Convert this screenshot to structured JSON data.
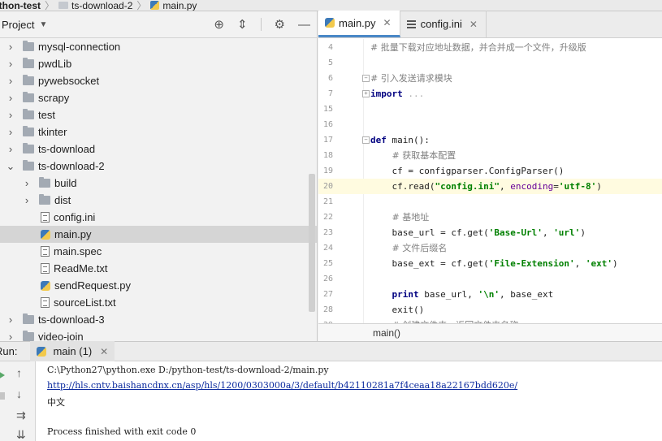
{
  "breadcrumb": [
    "ython-test",
    "ts-download-2",
    "main.py"
  ],
  "project": {
    "title": "Project",
    "items": [
      {
        "label": "mysql-connection",
        "type": "folder",
        "level": 0,
        "arrow": "›"
      },
      {
        "label": "pwdLib",
        "type": "folder",
        "level": 0,
        "arrow": "›"
      },
      {
        "label": "pywebsocket",
        "type": "folder",
        "level": 0,
        "arrow": "›"
      },
      {
        "label": "scrapy",
        "type": "folder",
        "level": 0,
        "arrow": "›"
      },
      {
        "label": "test",
        "type": "folder",
        "level": 0,
        "arrow": "›"
      },
      {
        "label": "tkinter",
        "type": "folder",
        "level": 0,
        "arrow": "›"
      },
      {
        "label": "ts-download",
        "type": "folder",
        "level": 0,
        "arrow": "›"
      },
      {
        "label": "ts-download-2",
        "type": "folder",
        "level": 0,
        "arrow": "⌄"
      },
      {
        "label": "build",
        "type": "folder",
        "level": 1,
        "arrow": "›"
      },
      {
        "label": "dist",
        "type": "folder",
        "level": 1,
        "arrow": "›"
      },
      {
        "label": "config.ini",
        "type": "file",
        "level": 1,
        "arrow": ""
      },
      {
        "label": "main.py",
        "type": "py",
        "level": 1,
        "arrow": "",
        "selected": true
      },
      {
        "label": "main.spec",
        "type": "file",
        "level": 1,
        "arrow": ""
      },
      {
        "label": "ReadMe.txt",
        "type": "file",
        "level": 1,
        "arrow": ""
      },
      {
        "label": "sendRequest.py",
        "type": "py",
        "level": 1,
        "arrow": ""
      },
      {
        "label": "sourceList.txt",
        "type": "file",
        "level": 1,
        "arrow": ""
      },
      {
        "label": "ts-download-3",
        "type": "folder",
        "level": 0,
        "arrow": "›"
      },
      {
        "label": "video-join",
        "type": "folder",
        "level": 0,
        "arrow": "›"
      }
    ]
  },
  "editor": {
    "tabs": [
      {
        "label": "main.py",
        "active": true
      },
      {
        "label": "config.ini",
        "active": false
      }
    ],
    "lines": [
      {
        "n": "4",
        "html": "<span class='cm'># 批量下载对应地址数据，并合并成一个文件，升级版</span>"
      },
      {
        "n": "5",
        "html": ""
      },
      {
        "n": "6",
        "html": "<span class='cm'># 引入发送请求模块</span>"
      },
      {
        "n": "7",
        "html": "<span class='kw'>import</span> <span class='fold'>...</span>"
      },
      {
        "n": "15",
        "html": ""
      },
      {
        "n": "16",
        "html": ""
      },
      {
        "n": "17",
        "html": "<span class='kw'>def</span> main():"
      },
      {
        "n": "18",
        "html": "    <span class='cm'># 获取基本配置</span>"
      },
      {
        "n": "19",
        "html": "    cf = configparser.ConfigParser()"
      },
      {
        "n": "20",
        "html": "    cf.read(<span class='st'>\"config.ini\"</span>, <span class='par'>encoding</span>=<span class='st'>'utf-8'</span>)",
        "current": true
      },
      {
        "n": "21",
        "html": ""
      },
      {
        "n": "22",
        "html": "    <span class='cm'># 基地址</span>"
      },
      {
        "n": "23",
        "html": "    base_url = cf.get(<span class='st'>'Base-Url'</span>, <span class='st'>'url'</span>)"
      },
      {
        "n": "24",
        "html": "    <span class='cm'># 文件后缀名</span>"
      },
      {
        "n": "25",
        "html": "    base_ext = cf.get(<span class='st'>'File-Extension'</span>, <span class='st'>'ext'</span>)"
      },
      {
        "n": "26",
        "html": ""
      },
      {
        "n": "27",
        "html": "    <span class='kw'>print</span> base_url, <span class='st'>'\\n'</span>, base_ext"
      },
      {
        "n": "28",
        "html": "    exit()"
      },
      {
        "n": "29",
        "html": "    <span class='cm'># 创建文件夹，返回文件夹名称</span>"
      }
    ],
    "footer": "main()"
  },
  "run": {
    "label": "Run:",
    "tab": "main (1)",
    "output": [
      {
        "text": "C:\\Python27\\python.exe D:/python-test/ts-download-2/main.py",
        "link": false
      },
      {
        "text": "http://hls.cntv.baishancdnx.cn/asp/hls/1200/0303000a/3/default/b42110281a7f4ceaa18a22167bdd620e/",
        "link": true
      },
      {
        "text": "中文",
        "link": false
      },
      {
        "text": "",
        "link": false
      },
      {
        "text": "Process finished with exit code 0",
        "link": false
      }
    ]
  }
}
